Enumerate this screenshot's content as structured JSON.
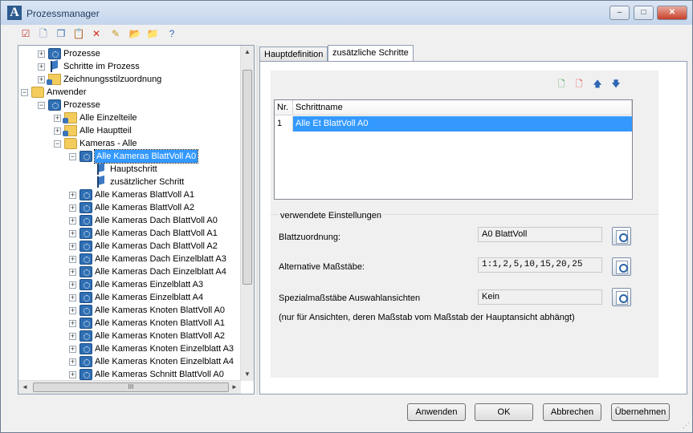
{
  "window": {
    "title": "Prozessmanager"
  },
  "titlebar_buttons": {
    "minimize": "–",
    "maximize": "□",
    "close": "✕"
  },
  "toolbar": [
    {
      "name": "checklist-icon",
      "glyph": "☑",
      "color": "#c23b2e"
    },
    {
      "name": "new-document-icon",
      "glyph": "🗋",
      "color": "#3a6fb5"
    },
    {
      "name": "copy-icon",
      "glyph": "❐",
      "color": "#3a6fb5"
    },
    {
      "name": "paste-icon",
      "glyph": "📋",
      "color": "#3a6fb5"
    },
    {
      "name": "delete-icon",
      "glyph": "✕",
      "color": "#d42a1b"
    },
    {
      "name": "edit-icon",
      "glyph": "✎",
      "color": "#c7961f"
    },
    {
      "name": "export-folder-icon",
      "glyph": "📂",
      "color": "#c7961f"
    },
    {
      "name": "import-folder-icon",
      "glyph": "📁",
      "color": "#c7961f"
    },
    {
      "name": "help-icon",
      "glyph": "?",
      "color": "#2e67b3"
    }
  ],
  "tree": [
    {
      "level": 1,
      "exp": "+",
      "icon": "gear",
      "label": "Prozesse"
    },
    {
      "level": 1,
      "exp": "+",
      "icon": "flag",
      "label": "Schritte im Prozess"
    },
    {
      "level": 1,
      "exp": "+",
      "icon": "folder-db",
      "label": "Zeichnungsstilzuordnung"
    },
    {
      "level": 0,
      "exp": "−",
      "icon": "folder",
      "label": "Anwender"
    },
    {
      "level": 1,
      "exp": "−",
      "icon": "gear",
      "label": "Prozesse"
    },
    {
      "level": 2,
      "exp": "+",
      "icon": "folder-db",
      "label": "Alle Einzelteile"
    },
    {
      "level": 2,
      "exp": "+",
      "icon": "folder-db",
      "label": "Alle Hauptteil"
    },
    {
      "level": 2,
      "exp": "−",
      "icon": "folder",
      "label": "Kameras - Alle"
    },
    {
      "level": 3,
      "exp": "−",
      "icon": "gear",
      "label": "Alle Kameras BlattVoll A0",
      "selected": true
    },
    {
      "level": 4,
      "exp": "",
      "icon": "flag",
      "label": "Hauptschritt"
    },
    {
      "level": 4,
      "exp": "",
      "icon": "flag",
      "label": "zusätzlicher Schritt"
    },
    {
      "level": 3,
      "exp": "+",
      "icon": "gear",
      "label": "Alle Kameras BlattVoll A1"
    },
    {
      "level": 3,
      "exp": "+",
      "icon": "gear",
      "label": "Alle Kameras BlattVoll A2"
    },
    {
      "level": 3,
      "exp": "+",
      "icon": "gear",
      "label": "Alle Kameras Dach BlattVoll A0"
    },
    {
      "level": 3,
      "exp": "+",
      "icon": "gear",
      "label": "Alle Kameras Dach BlattVoll A1"
    },
    {
      "level": 3,
      "exp": "+",
      "icon": "gear",
      "label": "Alle Kameras Dach BlattVoll A2"
    },
    {
      "level": 3,
      "exp": "+",
      "icon": "gear",
      "label": "Alle Kameras Dach Einzelblatt A3"
    },
    {
      "level": 3,
      "exp": "+",
      "icon": "gear",
      "label": "Alle Kameras Dach Einzelblatt A4"
    },
    {
      "level": 3,
      "exp": "+",
      "icon": "gear",
      "label": "Alle Kameras Einzelblatt A3"
    },
    {
      "level": 3,
      "exp": "+",
      "icon": "gear",
      "label": "Alle Kameras Einzelblatt A4"
    },
    {
      "level": 3,
      "exp": "+",
      "icon": "gear",
      "label": "Alle Kameras Knoten BlattVoll A0"
    },
    {
      "level": 3,
      "exp": "+",
      "icon": "gear",
      "label": "Alle Kameras Knoten BlattVoll A1"
    },
    {
      "level": 3,
      "exp": "+",
      "icon": "gear",
      "label": "Alle Kameras Knoten BlattVoll A2"
    },
    {
      "level": 3,
      "exp": "+",
      "icon": "gear",
      "label": "Alle Kameras Knoten Einzelblatt A3"
    },
    {
      "level": 3,
      "exp": "+",
      "icon": "gear",
      "label": "Alle Kameras Knoten Einzelblatt A4"
    },
    {
      "level": 3,
      "exp": "+",
      "icon": "gear",
      "label": "Alle Kameras Schnitt BlattVoll A0"
    }
  ],
  "tree_scroll": {
    "up": "▲",
    "down": "▼",
    "left": "◄",
    "right": "►",
    "grip": "III"
  },
  "tabs": [
    {
      "label": "Hauptdefinition",
      "active": false
    },
    {
      "label": "zusätzliche Schritte",
      "active": true
    }
  ],
  "step_toolbar": [
    {
      "name": "add-step-icon",
      "glyph": "🗋",
      "color": "#2e9a3a"
    },
    {
      "name": "remove-step-icon",
      "glyph": "🗋",
      "color": "#d42a1b"
    },
    {
      "name": "move-up-icon",
      "glyph": "🡅",
      "color": "#2e67b3"
    },
    {
      "name": "move-down-icon",
      "glyph": "🡇",
      "color": "#2e67b3"
    }
  ],
  "steps_table": {
    "columns": [
      "Nr.",
      "Schrittname"
    ],
    "rows": [
      {
        "nr": "1",
        "name": "Alle Et BlattVoll A0",
        "selected": true
      }
    ]
  },
  "settings": {
    "legend": "verwendete Einstellungen",
    "blattzuordnung_label": "Blattzuordnung:",
    "blattzuordnung_value": "A0 BlattVoll",
    "massstaebe_label": "Alternative Maßstäbe:",
    "massstaebe_value": "1:1,2,5,10,15,20,25",
    "spezial_label": "Spezialmaßstäbe Auswahlansichten",
    "spezial_value": "Kein",
    "footnote": "(nur für Ansichten, deren Maßstab vom Maßstab der Hauptansicht abhängt)"
  },
  "buttons": {
    "apply": "Anwenden",
    "ok": "OK",
    "cancel": "Abbrechen",
    "accept": "Übernehmen"
  },
  "colors": {
    "selection": "#3399ff"
  }
}
